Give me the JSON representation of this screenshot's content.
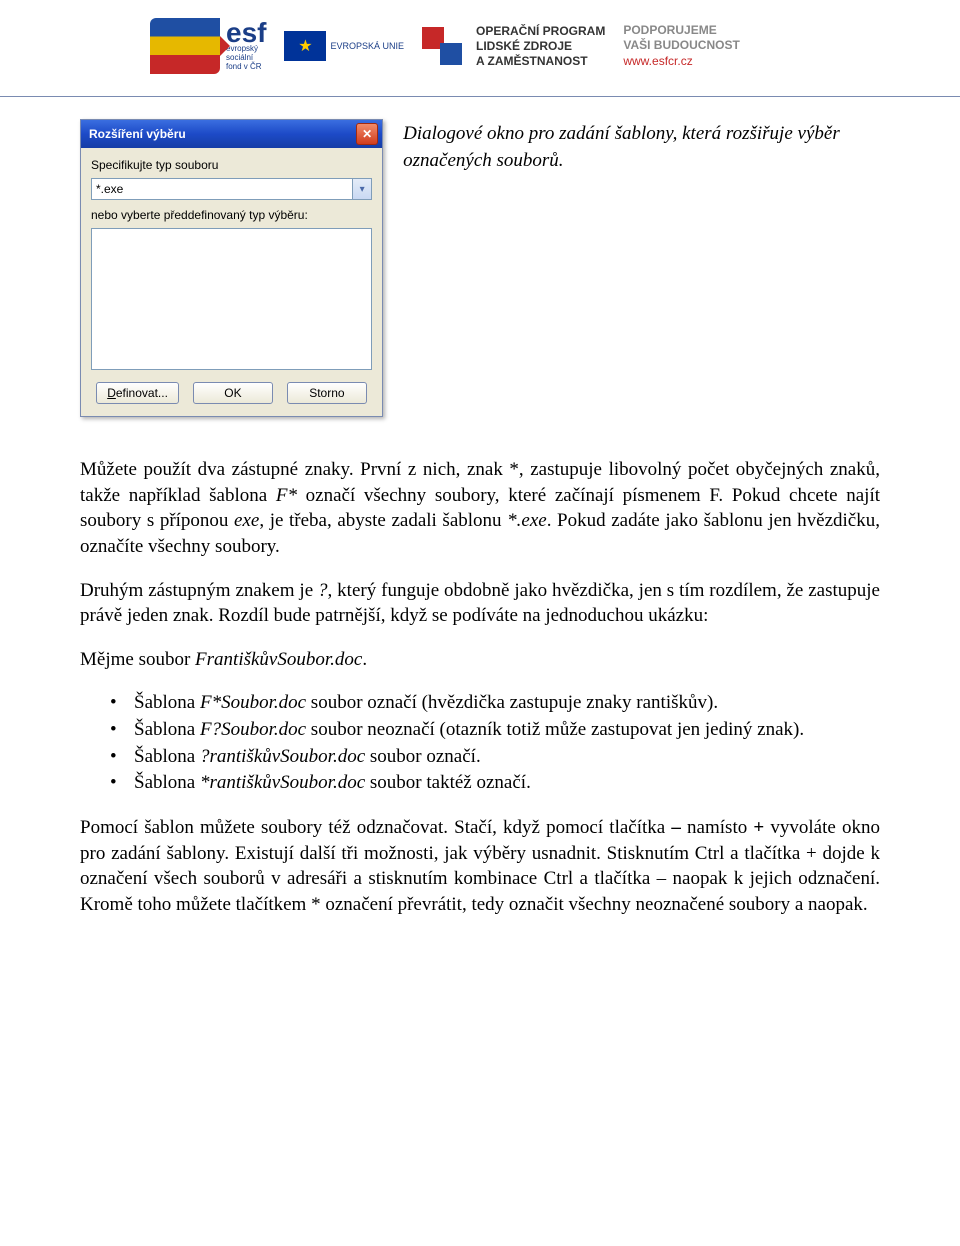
{
  "header": {
    "esf_main": "esf",
    "esf_sub": "evropský\nsociální\nfond v ČR",
    "eu_label": "EVROPSKÁ UNIE",
    "oplzz_line1": "OPERAČNÍ PROGRAM",
    "oplzz_line2": "LIDSKÉ ZDROJE",
    "oplzz_line3": "A ZAMĚSTNANOST",
    "support_line1": "PODPORUJEME",
    "support_line2": "VAŠI BUDOUCNOST",
    "support_url": "www.esfcr.cz"
  },
  "dialog": {
    "title": "Rozšíření výběru",
    "label_specify": "Specifikujte typ souboru",
    "combo_value": "*.exe",
    "label_predefined": "nebo vyberte předdefinovaný typ výběru:",
    "btn_define": "Definovat...",
    "btn_define_ul": "D",
    "btn_ok": "OK",
    "btn_cancel": "Storno"
  },
  "caption": "Dialogové okno pro zadání šablony, která rozšiřuje výběr označených souborů.",
  "para_intro_1": "Můžete použít dva zástupné znaky. První z nich, znak *, zastupuje libovolný počet obyčejných znaků, takže například šablona ",
  "para_intro_fstar": "F*",
  "para_intro_1b": " označí všechny soubory, které začínají písmenem F. Pokud chcete najít soubory s příponou ",
  "para_intro_exe": "exe",
  "para_intro_1c": ", je třeba, abyste zadali šablonu ",
  "para_intro_starexe": "*.exe",
  "para_intro_1d": ". Pokud zadáte jako šablonu jen hvězdičku, označíte všechny soubory.",
  "para_2a": "Druhým zástupným znakem je ",
  "para_2q": "?",
  "para_2b": ", který funguje obdobně jako hvězdička, jen s tím rozdílem, že zastupuje právě jeden znak. Rozdíl bude patrnější, když se podíváte na jednoduchou ukázku:",
  "para_3a": "Mějme soubor ",
  "para_3file": "FrantiškůvSoubor.doc",
  "para_3b": ".",
  "bullets": [
    {
      "pre": "Šablona ",
      "tpl": "F*Soubor.doc",
      "post": " soubor označí (hvězdička zastupuje znaky rantiškův)."
    },
    {
      "pre": "Šablona ",
      "tpl": "F?Soubor.doc",
      "post": " soubor neoznačí (otazník totiž může zastupovat jen jediný znak)."
    },
    {
      "pre": "Šablona ",
      "tpl": "?rantiškůvSoubor.doc",
      "post": " soubor označí."
    },
    {
      "pre": "Šablona ",
      "tpl": "*rantiškůvSoubor.doc",
      "post": " soubor taktéž označí."
    }
  ],
  "para_4a": "Pomocí šablon můžete soubory též odznačovat. Stačí, když pomocí tlačítka ",
  "para_4minus": "–",
  "para_4b": " namísto ",
  "para_4plus": "+",
  "para_4c": " vyvoláte okno pro zadání šablony. Existují další tři možnosti, jak výběry usnadnit. Stisknutím Ctrl a tlačítka + dojde k označení všech souborů v adresáři a stisknutím kombinace Ctrl a tlačítka – naopak k jejich odznačení. Kromě toho můžete tlačítkem * označení převrátit, tedy označit všechny neoznačené soubory a naopak."
}
